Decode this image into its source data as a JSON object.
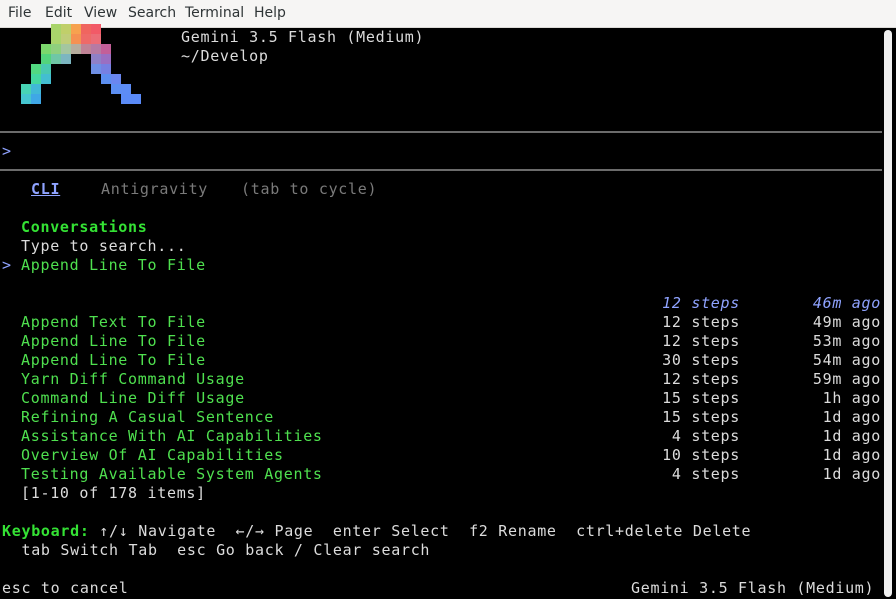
{
  "menu": [
    "File",
    "Edit",
    "View",
    "Search",
    "Terminal",
    "Help"
  ],
  "header": {
    "model": "Gemini 3.5 Flash (Medium)",
    "path": "~/Develop"
  },
  "prompt": {
    "symbol": ">",
    "value": ""
  },
  "tabs": {
    "active": "CLI",
    "inactive": "Antigravity",
    "hint": "(tab to cycle)"
  },
  "conversations": {
    "heading": "Conversations",
    "search_placeholder": "Type to search...",
    "selected_marker": ">",
    "selected": {
      "title": "Append Line To File",
      "steps": "12 steps",
      "ago": "46m ago"
    },
    "items": [
      {
        "title": "Append Text To File",
        "steps": "12 steps",
        "ago": "49m ago"
      },
      {
        "title": "Append Line To File",
        "steps": "12 steps",
        "ago": "53m ago"
      },
      {
        "title": "Append Line To File",
        "steps": "30 steps",
        "ago": "54m ago"
      },
      {
        "title": "Yarn Diff Command Usage",
        "steps": "12 steps",
        "ago": "59m ago"
      },
      {
        "title": "Command Line Diff Usage",
        "steps": "15 steps",
        "ago": "1h ago"
      },
      {
        "title": "Refining A Casual Sentence",
        "steps": "15 steps",
        "ago": "1d ago"
      },
      {
        "title": "Assistance With AI Capabilities",
        "steps": "4 steps",
        "ago": "1d ago"
      },
      {
        "title": "Overview Of AI Capabilities",
        "steps": "10 steps",
        "ago": "1d ago"
      },
      {
        "title": "Testing Available System Agents",
        "steps": "4 steps",
        "ago": "1d ago"
      }
    ],
    "pagination": "[1-10 of 178 items]"
  },
  "keyboard": {
    "label": "Keyboard:",
    "line1": " ↑/↓ Navigate  ←/→ Page  enter Select  f2 Rename  ctrl+delete Delete",
    "line2": "  tab Switch Tab  esc Go back / Clear search"
  },
  "footer": {
    "left": "esc to cancel",
    "right": "Gemini 3.5 Flash (Medium)"
  },
  "colors": {
    "accent": "#8fa3ff",
    "list_green": "#4fe04f",
    "heading_green": "#34e234",
    "background": "#000000"
  },
  "logo": {
    "pixels": [
      [
        3,
        0,
        "#a9d46b"
      ],
      [
        4,
        0,
        "#c0cf6a"
      ],
      [
        5,
        0,
        "#f7a24f"
      ],
      [
        6,
        0,
        "#f0655f"
      ],
      [
        7,
        0,
        "#f25a67"
      ],
      [
        3,
        1,
        "#a9d46b"
      ],
      [
        4,
        1,
        "#bfcd79"
      ],
      [
        5,
        1,
        "#f59152"
      ],
      [
        6,
        1,
        "#ee6a68"
      ],
      [
        7,
        1,
        "#ec6d77"
      ],
      [
        2,
        2,
        "#7bd76c"
      ],
      [
        3,
        2,
        "#8fcf7e"
      ],
      [
        4,
        2,
        "#a4c6a0"
      ],
      [
        5,
        2,
        "#b6ad9e"
      ],
      [
        6,
        2,
        "#c08396"
      ],
      [
        7,
        2,
        "#b77aa3"
      ],
      [
        8,
        2,
        "#c35f98"
      ],
      [
        2,
        3,
        "#53d47c"
      ],
      [
        3,
        3,
        "#6fc7a6"
      ],
      [
        4,
        3,
        "#7cb6c1"
      ],
      [
        7,
        3,
        "#8f80c7"
      ],
      [
        8,
        3,
        "#9a6fc2"
      ],
      [
        1,
        4,
        "#52d981"
      ],
      [
        2,
        4,
        "#49c9b2"
      ],
      [
        7,
        4,
        "#6f8fe5"
      ],
      [
        8,
        4,
        "#7680e2"
      ],
      [
        1,
        5,
        "#44d89f"
      ],
      [
        2,
        5,
        "#43bed1"
      ],
      [
        8,
        5,
        "#5c8ef0"
      ],
      [
        9,
        5,
        "#6a86ef"
      ],
      [
        0,
        6,
        "#48d4b5"
      ],
      [
        1,
        6,
        "#41b8d7"
      ],
      [
        9,
        6,
        "#5c8ef2"
      ],
      [
        10,
        6,
        "#5d8cf5"
      ],
      [
        0,
        7,
        "#45c6d0"
      ],
      [
        1,
        7,
        "#3fa7e6"
      ],
      [
        10,
        7,
        "#5b8bf7"
      ],
      [
        11,
        7,
        "#5a8af8"
      ]
    ]
  }
}
